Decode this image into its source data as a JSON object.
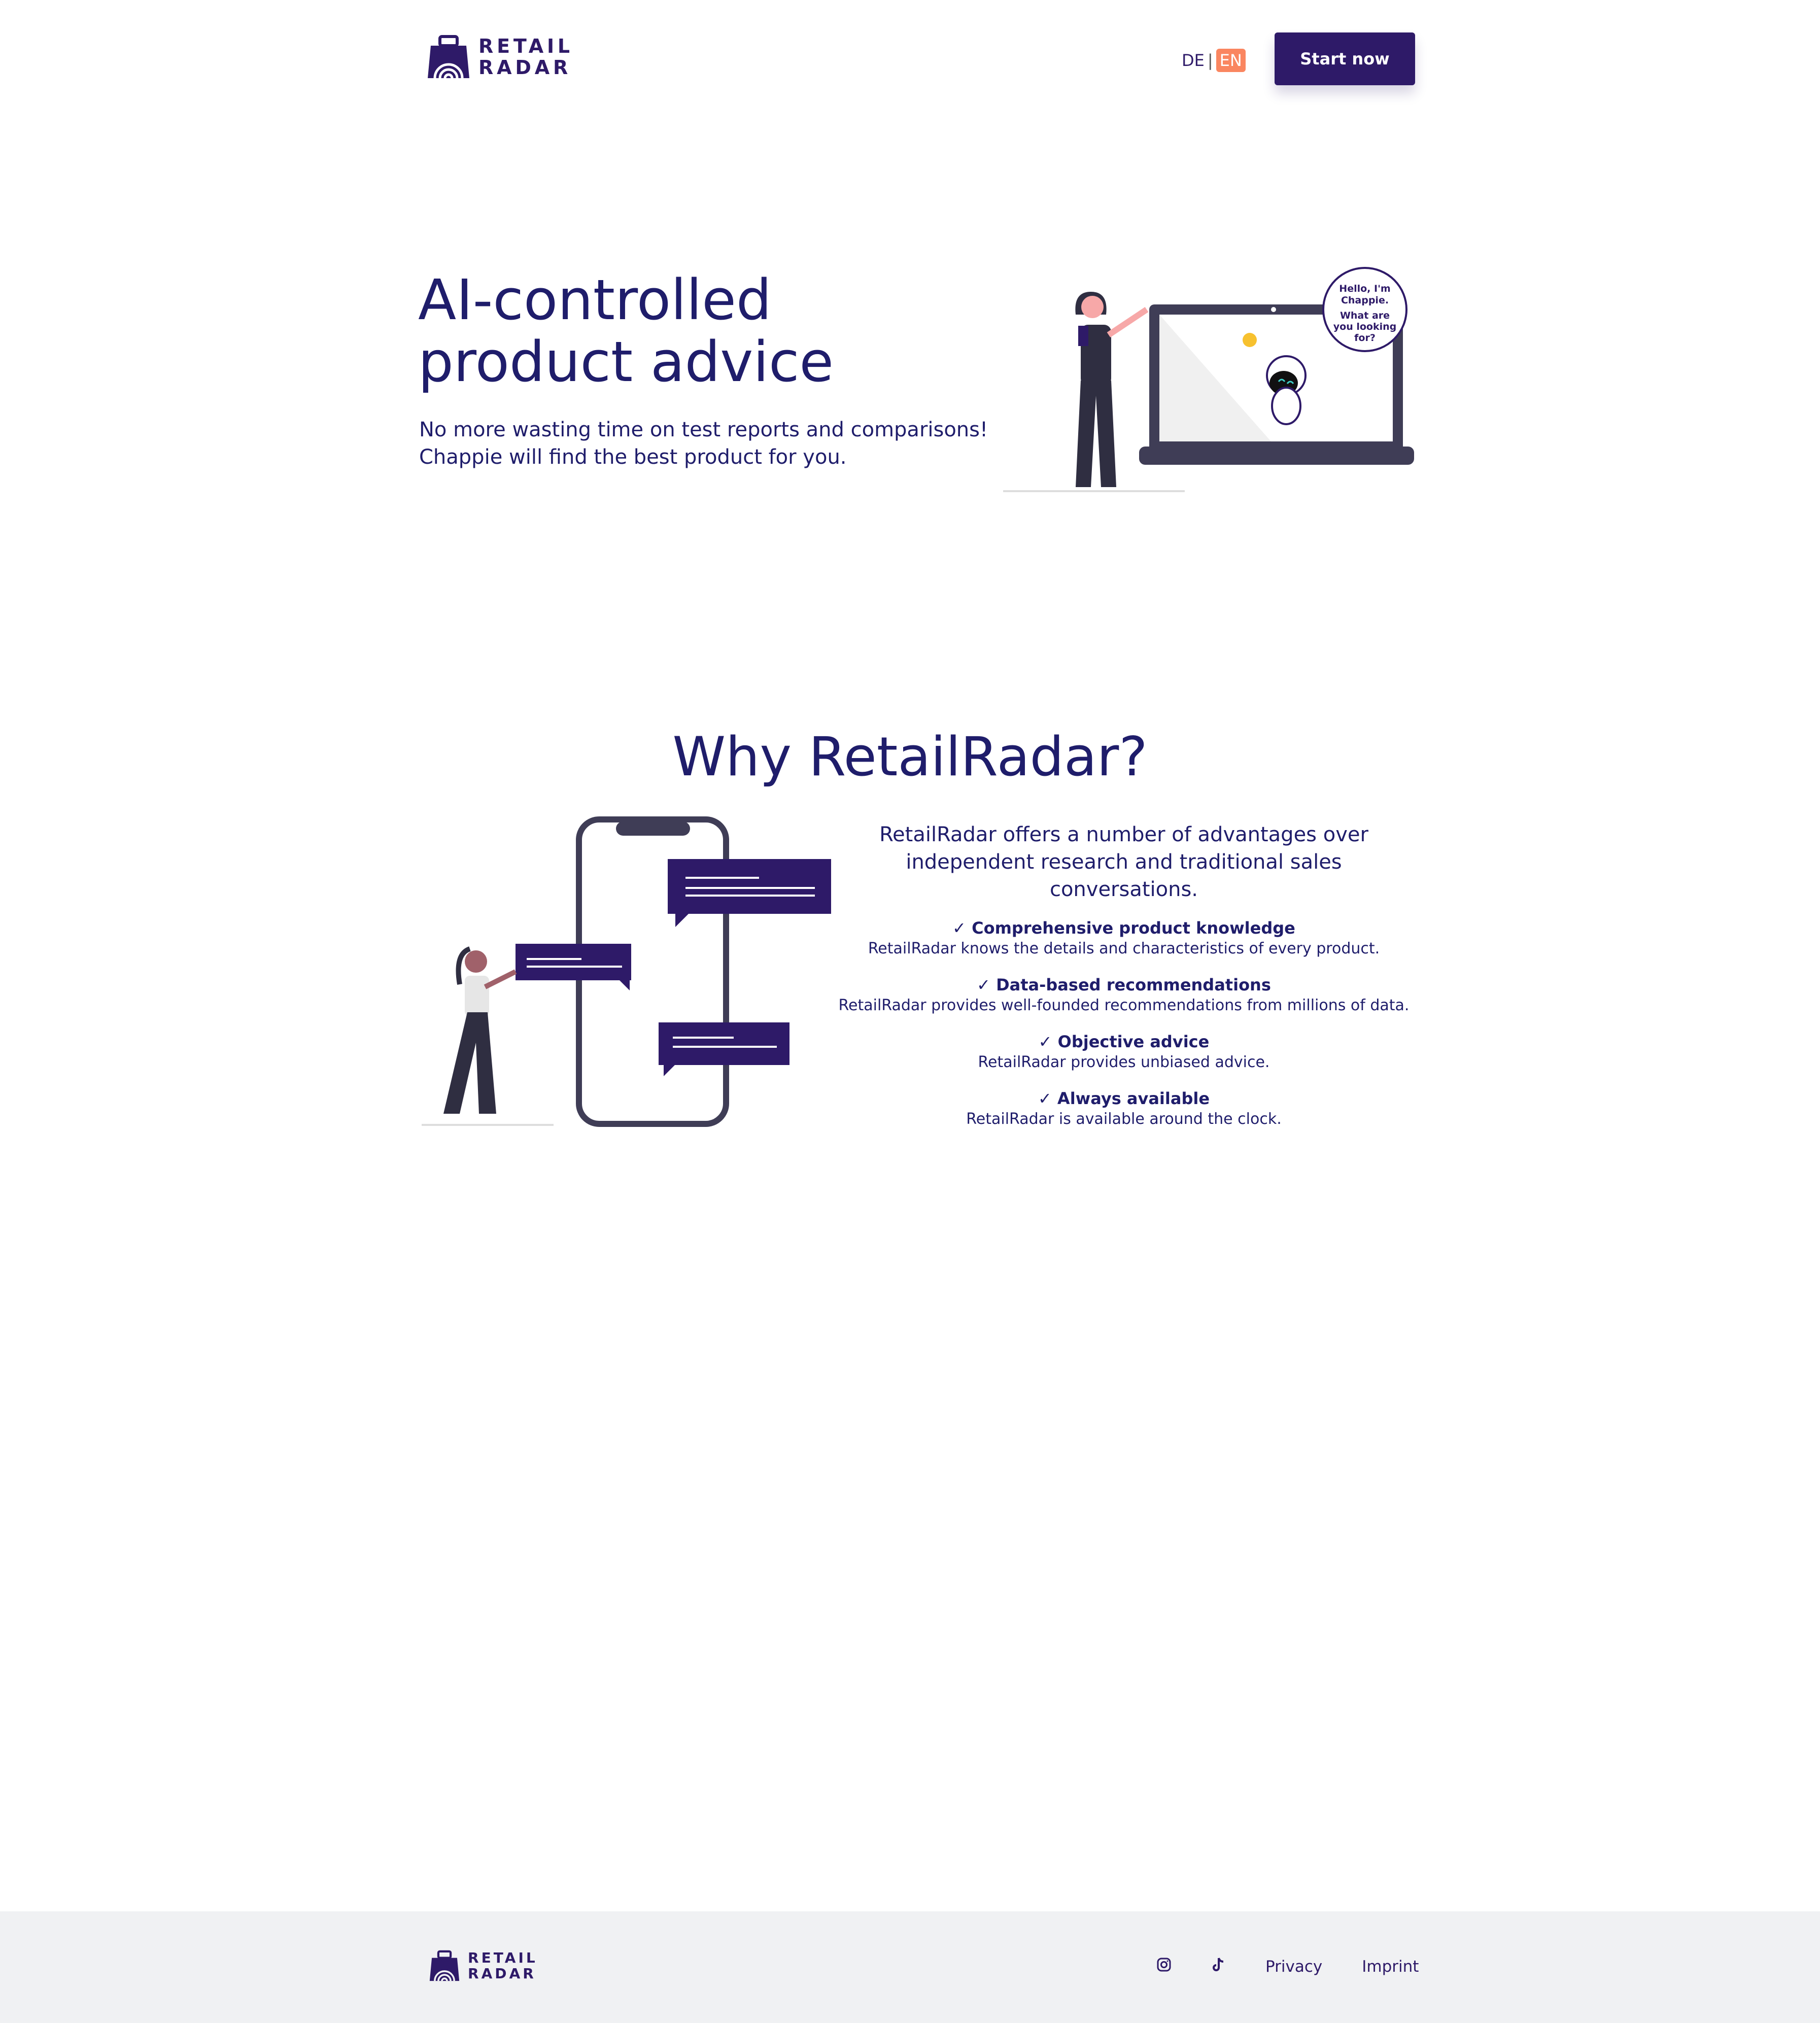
{
  "header": {
    "logo_line1": "RETAIL",
    "logo_line2": "RADAR",
    "lang_de": "DE",
    "lang_separator": "|",
    "lang_en": "EN",
    "start_label": "Start now"
  },
  "hero": {
    "title": "AI-controlled product advice",
    "subtitle": "No more wasting time on test reports and comparisons! Chappie will find the best product for you.",
    "bubble_line1": "Hello, I'm Chappie.",
    "bubble_line2": "What are you looking for?"
  },
  "why": {
    "title": "Why RetailRadar?",
    "intro": "RetailRadar offers a number of advantages over independent research and traditional sales conversations.",
    "features": [
      {
        "title": "✓ Comprehensive product knowledge",
        "desc": "RetailRadar knows the details and characteristics of every product."
      },
      {
        "title": "✓ Data-based recommendations",
        "desc": "RetailRadar provides well-founded recommendations from millions of data."
      },
      {
        "title": "✓ Objective advice",
        "desc": "RetailRadar provides unbiased advice."
      },
      {
        "title": "✓ Always available",
        "desc": "RetailRadar is available around the clock."
      }
    ]
  },
  "footer": {
    "logo_line1": "RETAIL",
    "logo_line2": "RADAR",
    "instagram_icon": "instagram-icon",
    "tiktok_icon": "tiktok-icon",
    "privacy": "Privacy",
    "imprint": "Imprint"
  },
  "colors": {
    "brand": "#2e1a68",
    "accent": "#fa8660",
    "text": "#1f1d6b",
    "footer_bg": "#f0f1f3"
  }
}
